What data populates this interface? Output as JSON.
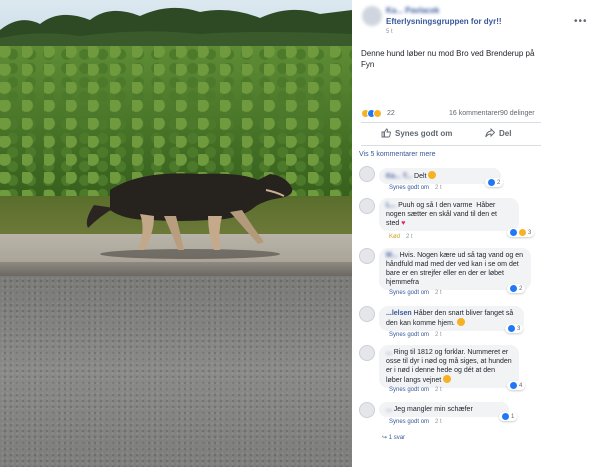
{
  "post": {
    "page_name": "Ka... Pavlacek",
    "group_name": "Efterlysningsgruppen for dyr!!",
    "timestamp": "5 t",
    "text": "Denne hund løber nu mod Bro ved Brenderup på Fyn",
    "reaction_count": "22",
    "comments_count": "16 kommentarer",
    "shares_count": "90 delinger",
    "like_label": "Synes godt om",
    "share_label": "Del",
    "view_more": "Vis 5 kommentarer mere"
  },
  "comments": [
    {
      "author": "Ka... T...",
      "text": "Delt",
      "like": "Synes godt om",
      "time": "2 t",
      "reactions": "2"
    },
    {
      "author": "L...",
      "text": "Puuh og så I den varme  Håber nogen sætter en skål vand til den et sted",
      "like": "Kød",
      "time": "2 t",
      "reactions": "3"
    },
    {
      "author": "M...",
      "text": "Hvis. Nogen kære ud så tag vand og en håndfuld mad med der ved kan i se om det bare er en strejfer eller en der er løbet hjemmefra",
      "like": "Synes godt om",
      "time": "2 t",
      "reactions": "2"
    },
    {
      "author": "...lelsen",
      "text": "Håber den snart bliver fanget så den kan komme hjem.",
      "like": "Synes godt om",
      "time": "2 t",
      "reactions": "3"
    },
    {
      "author": "...",
      "text": "Ring til 1812 og forklar. Nummeret er osse til dyr i nød og må siges, at hunden er i nød i denne hede og dét at den løber langs vejnet",
      "like": "Synes godt om",
      "time": "2 t",
      "reactions": "4"
    },
    {
      "author": "...",
      "text": "Jeg mangler min schæfer",
      "like": "Synes godt om",
      "time": "2 t",
      "reactions": "1"
    }
  ],
  "reply_link": "1 svar",
  "colors": {
    "link": "#385898",
    "bubble": "#f2f3f5",
    "muted": "#606770"
  }
}
